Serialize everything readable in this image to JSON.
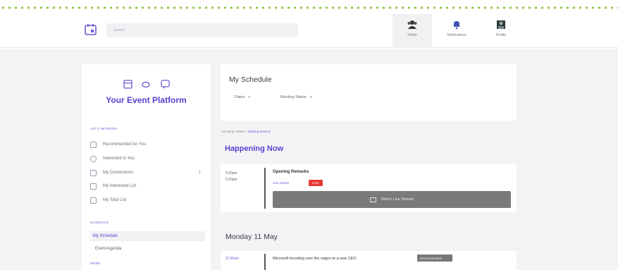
{
  "topbar": {
    "search_placeholder": "Search",
    "nav": [
      {
        "label": "Home",
        "icon": "team-icon",
        "active": true
      },
      {
        "label": "Notifications",
        "icon": "bell-icon",
        "active": false
      },
      {
        "label": "Profile",
        "icon": "profile-icon",
        "active": false
      }
    ]
  },
  "sidebar": {
    "brand": "Your Event Platform",
    "sections": [
      {
        "title": "LET'S NETWORK",
        "items": [
          {
            "label": "Recommended for You",
            "icon": "recommend-icon"
          },
          {
            "label": "Interested in You",
            "icon": "star-icon"
          },
          {
            "label": "My Connections",
            "icon": "connections-icon",
            "count": "1"
          },
          {
            "label": "My Interested List",
            "icon": "list-icon"
          },
          {
            "label": "My Total List",
            "icon": "total-list-icon"
          }
        ]
      },
      {
        "title": "SCHEDULE",
        "items": [
          {
            "label": "My Schedule",
            "active": true
          },
          {
            "label": "Event Agenda"
          }
        ]
      },
      {
        "title": "MORE"
      }
    ]
  },
  "schedule": {
    "title": "My Schedule",
    "filters": [
      "Dates",
      "Meeting Status"
    ],
    "breadcrumb_prefix": "Showing: Dates > ",
    "breadcrumb_link": "Starting Session",
    "happening_heading": "Happening Now",
    "session1": {
      "start": "3:30pm",
      "end": "5:00pm",
      "title": "Opening Remarks",
      "meta": "Join stream",
      "badge": "LIVE",
      "watch_label": "Watch Live Stream"
    },
    "day_heading": "Monday 11 May",
    "session2": {
      "start": "11:00am",
      "title": "Microsoft founding over the reigns to a new CEO",
      "badge": "Recommended"
    }
  },
  "colors": {
    "accent": "#5b3fd1",
    "live": "#e53935",
    "dots": "#8cc63f"
  }
}
